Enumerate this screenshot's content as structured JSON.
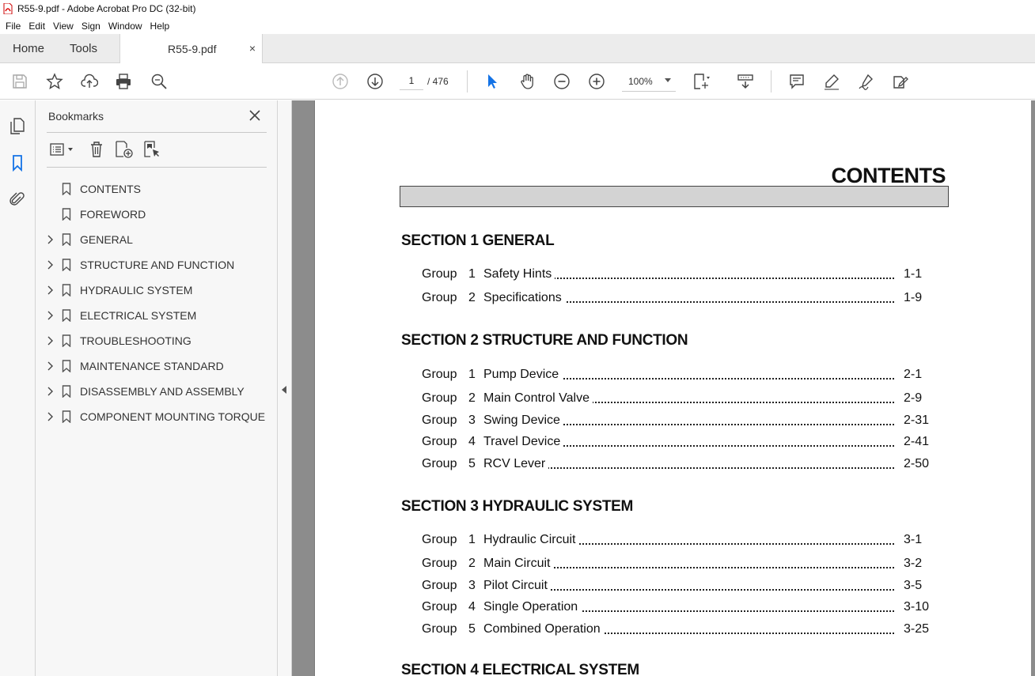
{
  "window": {
    "title": "R55-9.pdf - Adobe Acrobat Pro DC (32-bit)"
  },
  "menu": [
    "File",
    "Edit",
    "View",
    "Sign",
    "Window",
    "Help"
  ],
  "tabs": {
    "home": "Home",
    "tools": "Tools",
    "document": "R55-9.pdf",
    "close": "×"
  },
  "toolbar": {
    "page_current": "1",
    "page_total": "/ 476",
    "zoom": "100%"
  },
  "bookmarks": {
    "title": "Bookmarks",
    "items": [
      {
        "label": "CONTENTS",
        "expandable": false
      },
      {
        "label": "FOREWORD",
        "expandable": false
      },
      {
        "label": "GENERAL",
        "expandable": true
      },
      {
        "label": "STRUCTURE AND FUNCTION",
        "expandable": true
      },
      {
        "label": "HYDRAULIC SYSTEM",
        "expandable": true
      },
      {
        "label": "ELECTRICAL SYSTEM",
        "expandable": true
      },
      {
        "label": "TROUBLESHOOTING",
        "expandable": true
      },
      {
        "label": "MAINTENANCE STANDARD",
        "expandable": true
      },
      {
        "label": "DISASSEMBLY AND ASSEMBLY",
        "expandable": true
      },
      {
        "label": "COMPONENT MOUNTING TORQUE",
        "expandable": true
      }
    ]
  },
  "document": {
    "heading": "CONTENTS",
    "sections": [
      {
        "title": "SECTION 1  GENERAL",
        "groups": [
          {
            "group": "Group",
            "num": "1",
            "title": "Safety Hints",
            "page": "1-1"
          },
          {
            "group": "Group",
            "num": "2",
            "title": "Specifications",
            "page": "1-9"
          }
        ]
      },
      {
        "title": "SECTION 2  STRUCTURE AND FUNCTION",
        "groups": [
          {
            "group": "Group",
            "num": "1",
            "title": "Pump Device",
            "page": "2-1"
          },
          {
            "group": "Group",
            "num": "2",
            "title": "Main Control Valve",
            "page": "2-9"
          },
          {
            "group": "Group",
            "num": "3",
            "title": "Swing Device",
            "page": "2-31"
          },
          {
            "group": "Group",
            "num": "4",
            "title": "Travel Device",
            "page": "2-41"
          },
          {
            "group": "Group",
            "num": "5",
            "title": "RCV Lever",
            "page": "2-50"
          }
        ]
      },
      {
        "title": "SECTION 3  HYDRAULIC SYSTEM",
        "groups": [
          {
            "group": "Group",
            "num": "1",
            "title": "Hydraulic Circuit",
            "page": "3-1"
          },
          {
            "group": "Group",
            "num": "2",
            "title": "Main Circuit",
            "page": "3-2"
          },
          {
            "group": "Group",
            "num": "3",
            "title": "Pilot Circuit",
            "page": "3-5"
          },
          {
            "group": "Group",
            "num": "4",
            "title": "Single Operation",
            "page": "3-10"
          },
          {
            "group": "Group",
            "num": "5",
            "title": "Combined Operation",
            "page": "3-25"
          }
        ]
      },
      {
        "title": "SECTION 4  ELECTRICAL SYSTEM",
        "groups": []
      }
    ]
  }
}
